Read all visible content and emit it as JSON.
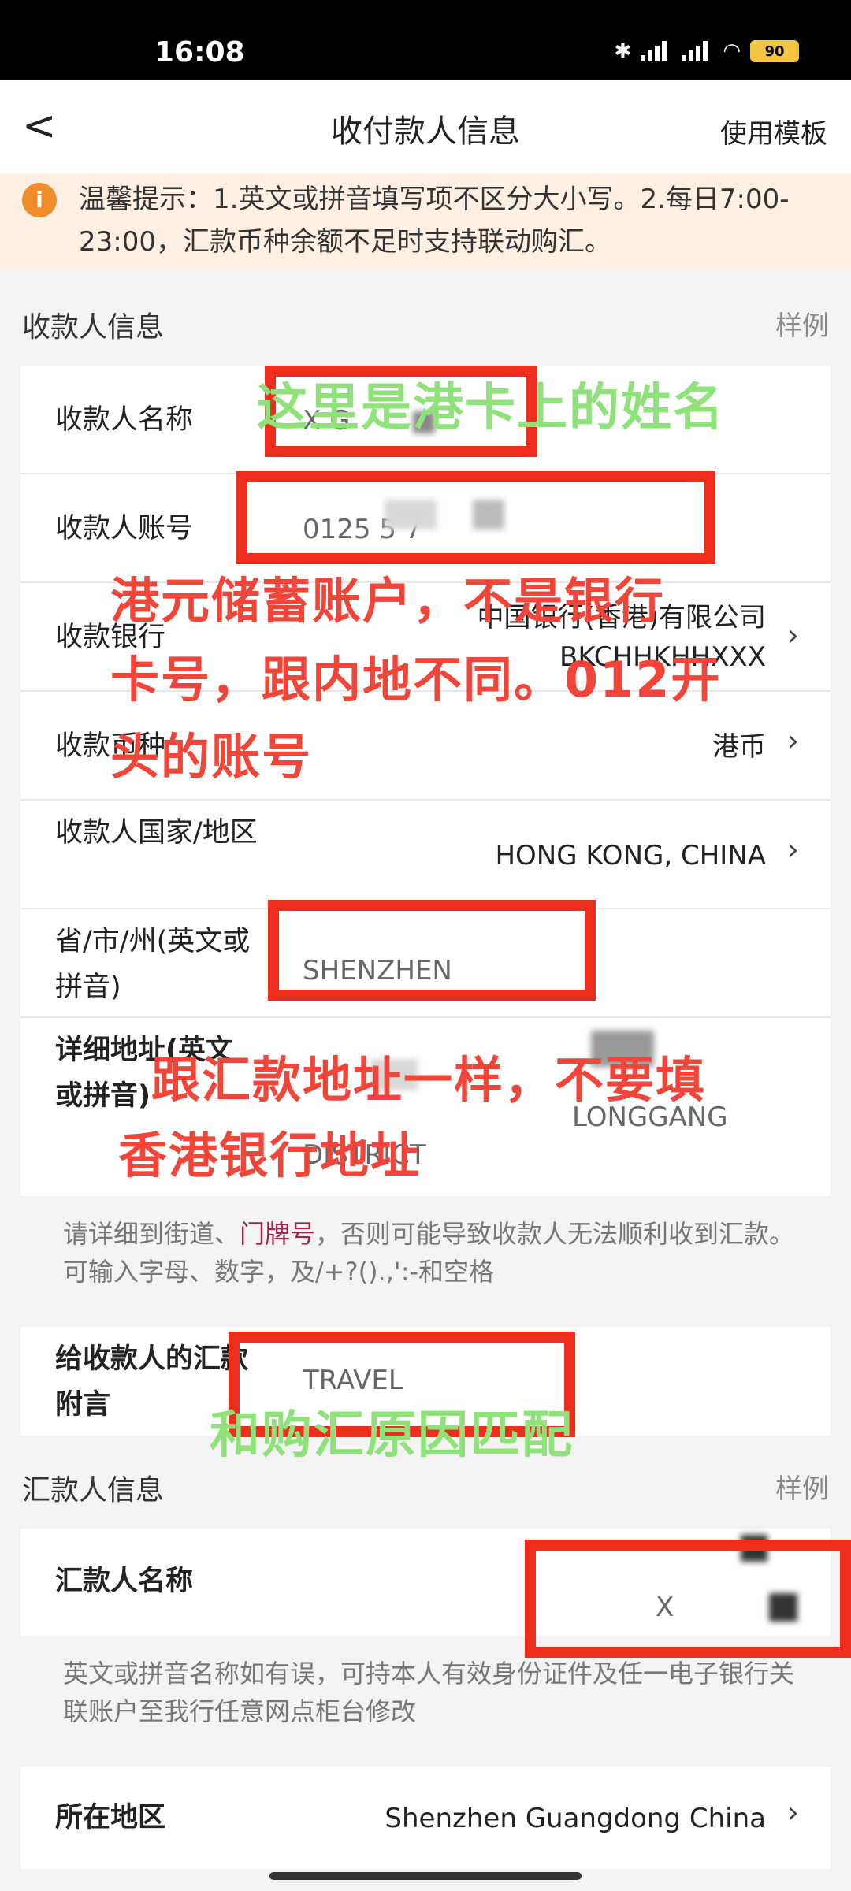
{
  "status": {
    "time": "16:08",
    "battery": "90"
  },
  "nav": {
    "back": "<",
    "title": "收付款人信息",
    "template": "使用模板"
  },
  "notice": {
    "icon": "i",
    "text": "温馨提示：1.英文或拼音填写项不区分大小写。2.每日7:00-23:00，汇款币种余额不足时支持联动购汇。"
  },
  "payee_section": {
    "title": "收款人信息",
    "sample": "样例",
    "name_label": "收款人名称",
    "name_value": "X          G",
    "account_label": "收款人账号",
    "account_value": "0125              5        7",
    "bank_label": "收款银行",
    "bank_name": "中国银行(香港)有限公司",
    "bank_code": "BKCHHKHHXXX",
    "currency_label": "收款币种",
    "currency_value": "港币",
    "country_label": "收款人国家/地区",
    "country_value": "HONG KONG, CHINA",
    "province_label": "省/市/州(英文或拼音)",
    "province_value": "SHENZHEN",
    "address_label": "详细地址(英文或拼音)",
    "address_value": "LONGGANG",
    "address_value2": "DISTRICT",
    "hint_before": "请详细到街道、",
    "hint_red": "门牌号",
    "hint_after": "，否则可能导致收款人无法顺利收到汇款。可输入字母、数字，及/+?().,':-和空格",
    "remark_label": "给收款人的汇款附言",
    "remark_value": "TRAVEL"
  },
  "payer_section": {
    "title": "汇款人信息",
    "sample": "样例",
    "name_label": "汇款人名称",
    "name_value": "X",
    "hint": "英文或拼音名称如有误，可持本人有效身份证件及任一电子银行关联账户至我行任意网点柜台修改",
    "region_label": "所在地区",
    "region_value": "Shenzhen Guangdong China"
  },
  "annotations": {
    "name_note": "这里是港卡上的姓名",
    "account_note_1": "港元储蓄账户，不是银行",
    "account_note_2": "卡号，跟内地不同。012开",
    "account_note_3": "头的账号",
    "address_note_1": "跟汇款地址一样，不要填",
    "address_note_2": "香港银行地址",
    "remark_note": "和购汇原因匹配"
  },
  "colors": {
    "annotation_red": "#ee2e1c",
    "annotation_green": "#8fe27a",
    "notice_bg": "#fdf0e2",
    "notice_icon": "#f08c2a"
  }
}
